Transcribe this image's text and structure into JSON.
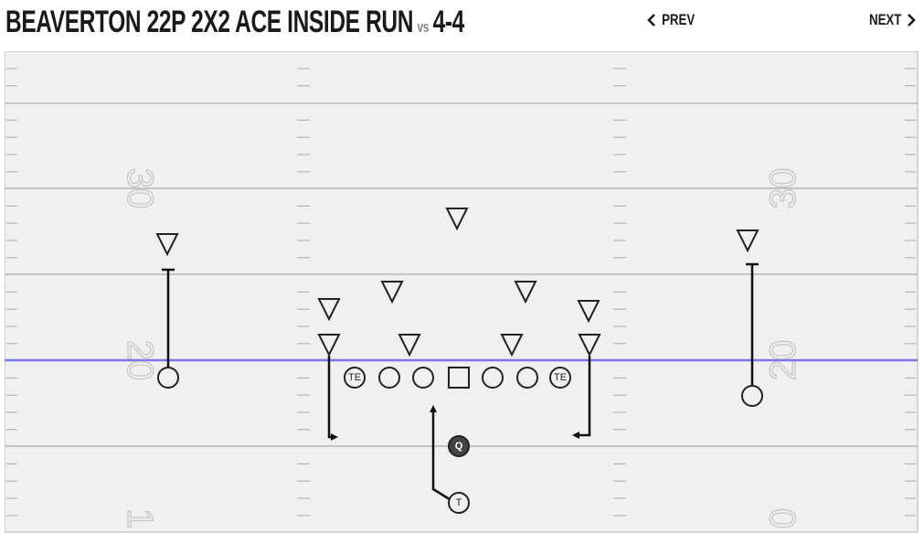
{
  "header": {
    "play_name": "BEAVERTON 22P 2X2 ACE INSIDE RUN",
    "vs_label": "vs",
    "defense_name": "4-4",
    "prev_label": "PREV",
    "next_label": "NEXT"
  },
  "field": {
    "background_color": "#f0f0f0",
    "line_color": "#b4b4b4",
    "line_of_scrimmage_color": "#7878e6",
    "yard_numbers": [
      "30",
      "20",
      "1",
      "30",
      "20",
      "0"
    ]
  },
  "offense": {
    "players": [
      {
        "role": "wide-receiver-left",
        "label": ""
      },
      {
        "role": "tight-end-left",
        "label": "TE"
      },
      {
        "role": "left-tackle",
        "label": ""
      },
      {
        "role": "left-guard",
        "label": ""
      },
      {
        "role": "center",
        "label": ""
      },
      {
        "role": "right-guard",
        "label": ""
      },
      {
        "role": "right-tackle",
        "label": ""
      },
      {
        "role": "tight-end-right",
        "label": "TE"
      },
      {
        "role": "wide-receiver-right",
        "label": ""
      },
      {
        "role": "quarterback",
        "label": "Q"
      },
      {
        "role": "tailback",
        "label": "T"
      }
    ]
  },
  "defense": {
    "player_count": 11,
    "symbol": "triangle"
  }
}
